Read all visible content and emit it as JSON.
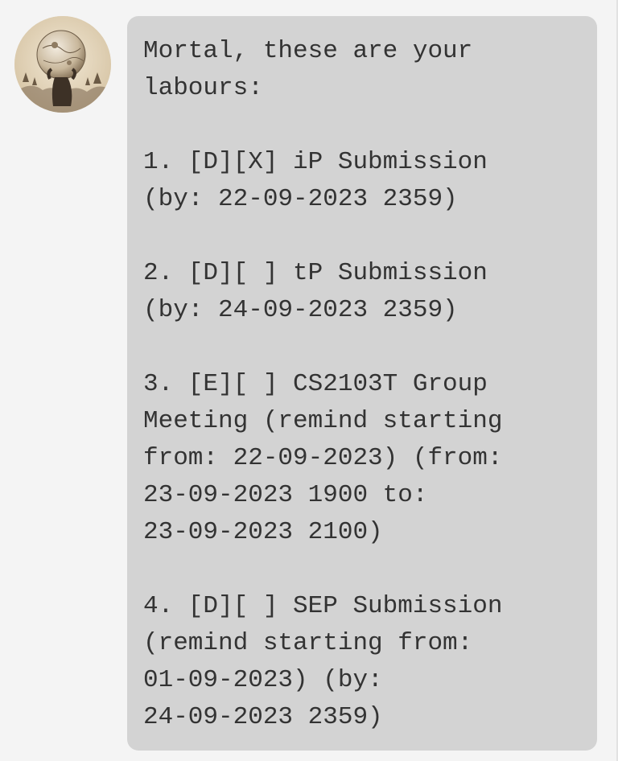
{
  "chat": {
    "avatar": {
      "icon": "atlas-holding-globe-avatar"
    },
    "message": {
      "text": "Mortal, these are your\nlabours:\n\n1. [D][X] iP Submission\n(by: 22-09-2023 2359)\n\n2. [D][ ] tP Submission\n(by: 24-09-2023 2359)\n\n3. [E][ ] CS2103T Group\nMeeting (remind starting\nfrom: 22-09-2023) (from:\n23-09-2023 1900 to:\n23-09-2023 2100)\n\n4. [D][ ] SEP Submission\n(remind starting from:\n01-09-2023) (by:\n24-09-2023 2359)"
    }
  },
  "colors": {
    "background": "#f4f4f4",
    "bubble": "#d3d3d3",
    "text": "#333333"
  }
}
